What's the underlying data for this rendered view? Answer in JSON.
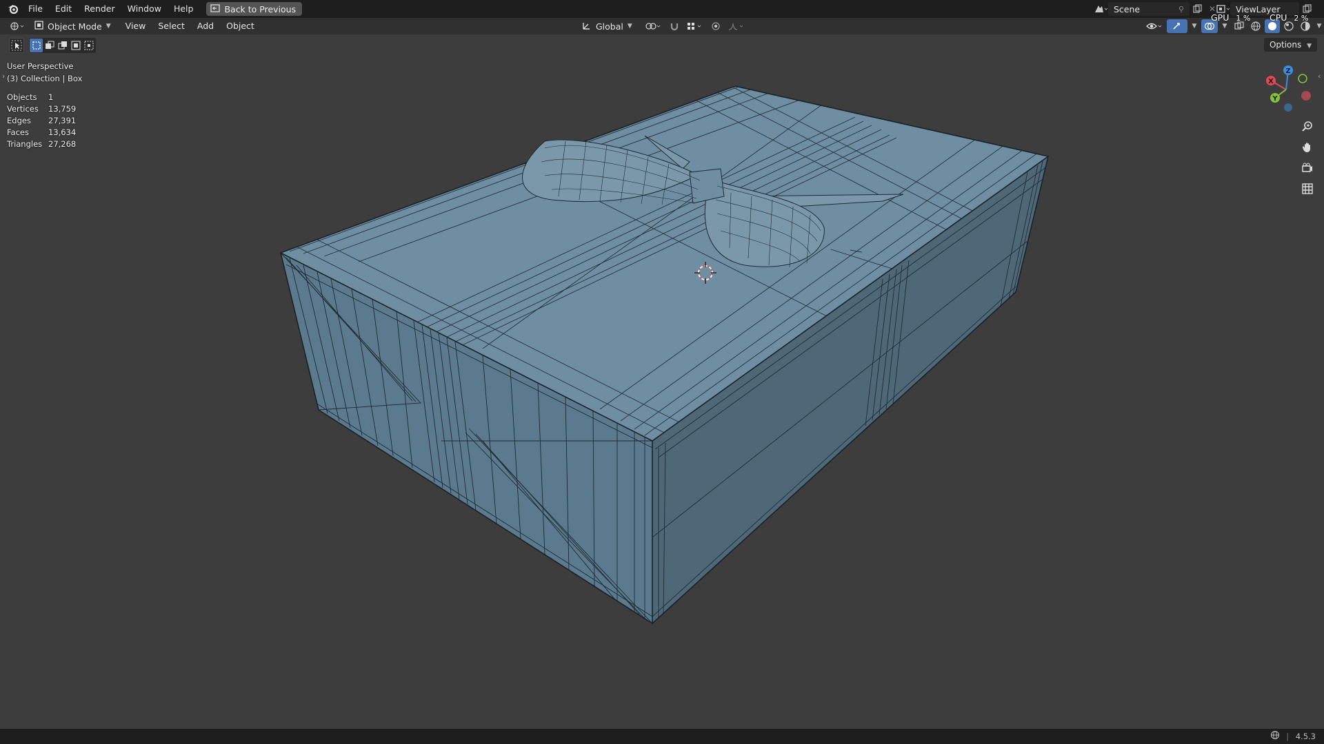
{
  "menubar": {
    "items": [
      "File",
      "Edit",
      "Render",
      "Window",
      "Help"
    ],
    "back_button": "Back to Previous",
    "scene_field": "Scene",
    "viewlayer_field": "ViewLayer"
  },
  "header": {
    "mode": "Object Mode",
    "menus": [
      "View",
      "Select",
      "Add",
      "Object"
    ],
    "orientation": "Global",
    "options": "Options"
  },
  "viewport": {
    "perspective": "User Perspective",
    "collection": "(3) Collection | Box"
  },
  "stats": [
    {
      "label": "Objects",
      "value": "1"
    },
    {
      "label": "Vertices",
      "value": "13,759"
    },
    {
      "label": "Edges",
      "value": "27,391"
    },
    {
      "label": "Faces",
      "value": "13,634"
    },
    {
      "label": "Triangles",
      "value": "27,268"
    }
  ],
  "perf": {
    "gpu_label": "GPU",
    "gpu_value": "1 %",
    "cpu_label": "CPU",
    "cpu_value": "2 %"
  },
  "gizmo": {
    "x": "X",
    "y": "Y",
    "z": "Z"
  },
  "statusbar": {
    "version": "4.5.3"
  },
  "colors": {
    "viewport_bg": "#3d3d3d",
    "mesh_top": "#7b98ab",
    "mesh_side_dark": "#4d6676",
    "wire": "#1c2a33",
    "axis_x": "#e04a56",
    "axis_y": "#86c13b",
    "axis_z": "#3e8ee0"
  }
}
